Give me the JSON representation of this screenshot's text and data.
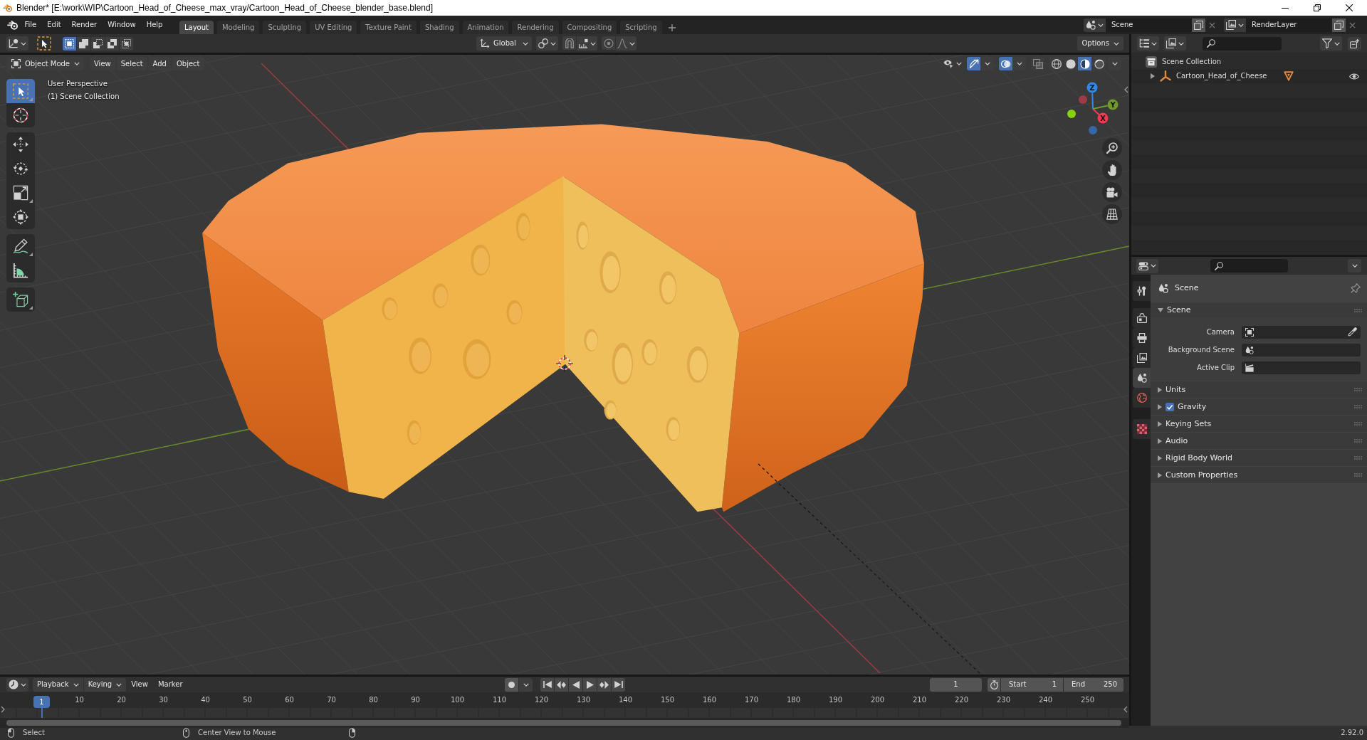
{
  "window": {
    "title": "Blender* [E:\\work\\WIP\\Cartoon_Head_of_Cheese_max_vray/Cartoon_Head_of_Cheese_blender_base.blend]"
  },
  "top_bar": {
    "menus": [
      "File",
      "Edit",
      "Render",
      "Window",
      "Help"
    ],
    "workspace_tabs": [
      {
        "label": "Layout",
        "selected": true
      },
      {
        "label": "Modeling",
        "selected": false
      },
      {
        "label": "Sculpting",
        "selected": false
      },
      {
        "label": "UV Editing",
        "selected": false
      },
      {
        "label": "Texture Paint",
        "selected": false
      },
      {
        "label": "Shading",
        "selected": false
      },
      {
        "label": "Animation",
        "selected": false
      },
      {
        "label": "Rendering",
        "selected": false
      },
      {
        "label": "Compositing",
        "selected": false
      },
      {
        "label": "Scripting",
        "selected": false
      }
    ],
    "scene": "Scene",
    "view_layer": "RenderLayer"
  },
  "viewport": {
    "tool_header": {
      "select_modes": [
        {
          "kind": "set",
          "selected": true
        },
        {
          "kind": "extend",
          "selected": false
        },
        {
          "kind": "subtract",
          "selected": false
        },
        {
          "kind": "invert",
          "selected": false
        },
        {
          "kind": "intersect",
          "selected": false
        }
      ],
      "orientation": "Global",
      "options": "Options"
    },
    "header": {
      "mode": "Object Mode",
      "menus": [
        "View",
        "Select",
        "Add",
        "Object"
      ],
      "toggles": [
        {
          "kind": "gizmos",
          "on": true
        },
        {
          "kind": "overlays",
          "on": true
        },
        {
          "kind": "xray",
          "on": false
        }
      ],
      "shading_modes": [
        {
          "kind": "wireframe",
          "selected": false
        },
        {
          "kind": "solid",
          "selected": false
        },
        {
          "kind": "material",
          "selected": true
        },
        {
          "kind": "rendered",
          "selected": false
        }
      ]
    },
    "info": [
      "User Perspective",
      "(1) Scene Collection"
    ],
    "toolbar": [
      {
        "tools": [
          {
            "kind": "select-box",
            "selected": true,
            "more": true
          },
          {
            "kind": "cursor",
            "selected": false
          }
        ]
      },
      {
        "tools": [
          {
            "kind": "move",
            "selected": false
          },
          {
            "kind": "rotate",
            "selected": false
          },
          {
            "kind": "scale",
            "selected": false,
            "more": true
          },
          {
            "kind": "transform",
            "selected": false
          }
        ]
      },
      {
        "tools": [
          {
            "kind": "annotate",
            "selected": false,
            "more": true
          },
          {
            "kind": "measure",
            "selected": false
          }
        ]
      },
      {
        "tools": [
          {
            "kind": "add-cube",
            "selected": false,
            "more": true
          }
        ]
      }
    ],
    "navigation_gizmo": {
      "axes": [
        {
          "label": "X",
          "color": "#f23a50"
        },
        {
          "label": "Y",
          "color": "#6f9a2b"
        },
        {
          "label": "Z",
          "color": "#2e8ae6"
        }
      ],
      "negative_axes": [
        {
          "color": "#9c3b47"
        },
        {
          "color": "#86d30d"
        },
        {
          "color": "#3467a8"
        }
      ]
    }
  },
  "outliner": {
    "items": [
      {
        "label": "Scene Collection",
        "children": [
          {
            "label": "Cartoon_Head_of_Cheese",
            "expanded": false
          }
        ]
      }
    ]
  },
  "properties": {
    "tab_groups": [
      {
        "tabs": [
          {
            "kind": "tool",
            "selected": false
          }
        ]
      },
      {
        "tabs": [
          {
            "kind": "render",
            "selected": false
          },
          {
            "kind": "output",
            "selected": false
          },
          {
            "kind": "view-layer",
            "selected": false
          },
          {
            "kind": "scene",
            "selected": true
          },
          {
            "kind": "world",
            "selected": false
          }
        ]
      },
      {
        "tabs": [
          {
            "kind": "texture",
            "selected": false
          }
        ]
      }
    ],
    "context": "Scene",
    "panels": [
      {
        "label": "Scene",
        "expanded": true,
        "fields": [
          {
            "label": "Camera",
            "kind": "camera"
          },
          {
            "label": "Background Scene",
            "kind": "scene"
          },
          {
            "label": "Active Clip",
            "kind": "clip"
          }
        ]
      },
      {
        "label": "Units",
        "expanded": false
      },
      {
        "label": "Gravity",
        "expanded": false,
        "checked": true
      },
      {
        "label": "Keying Sets",
        "expanded": false
      },
      {
        "label": "Audio",
        "expanded": false
      },
      {
        "label": "Rigid Body World",
        "expanded": false
      },
      {
        "label": "Custom Properties",
        "expanded": false
      }
    ]
  },
  "timeline": {
    "menus": [
      {
        "label": "Playback",
        "kind": "dropdown"
      },
      {
        "label": "Keying",
        "kind": "dropdown"
      },
      {
        "label": "View",
        "kind": "menu"
      },
      {
        "label": "Marker",
        "kind": "menu"
      }
    ],
    "current_frame": "1",
    "start": {
      "label": "Start",
      "value": "1"
    },
    "end": {
      "label": "End",
      "value": "250"
    },
    "playhead": "1",
    "ruler": [
      "10",
      "20",
      "30",
      "40",
      "50",
      "60",
      "70",
      "80",
      "90",
      "100",
      "110",
      "120",
      "130",
      "140",
      "150",
      "160",
      "170",
      "180",
      "190",
      "200",
      "210",
      "220",
      "230",
      "240",
      "250"
    ]
  },
  "status_bar": {
    "hints": [
      {
        "kind": "left",
        "label": "Select"
      },
      {
        "kind": "middle",
        "label": "Center View to Mouse"
      },
      {
        "kind": "right"
      }
    ],
    "version": "2.92.0"
  }
}
